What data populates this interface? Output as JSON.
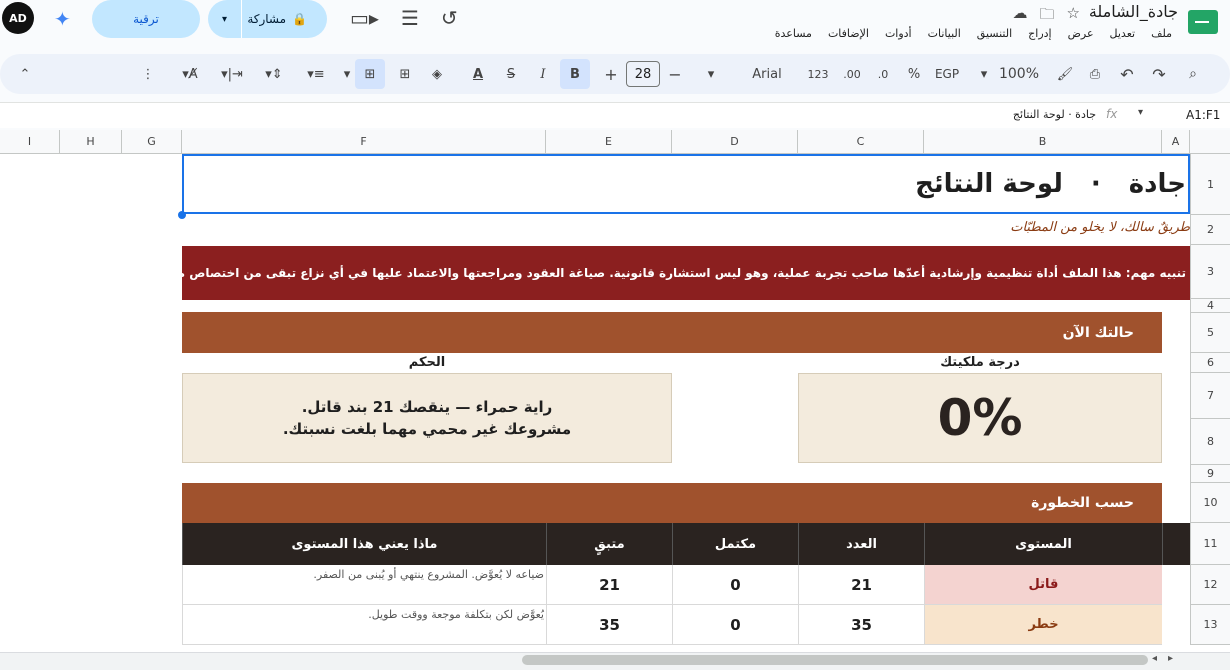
{
  "title_bar": {
    "doc_title": "جادة_الشاملة",
    "menu": [
      "ملف",
      "تعديل",
      "عرض",
      "إدراج",
      "التنسيق",
      "البيانات",
      "أدوات",
      "الإضافات",
      "مساعدة"
    ],
    "share_label": "مشاركة",
    "upgrade_label": "ترقية",
    "avatar_text": "AD"
  },
  "toolbar": {
    "zoom": "100%",
    "currency": "EGP",
    "percent": "%",
    "decimal_dec": ".0",
    "decimal_inc": ".00",
    "number_format": "123",
    "font": "Arial",
    "font_size": "28",
    "bold": "B",
    "italic": "I",
    "underline_letter": "A"
  },
  "formula_bar": {
    "cell_ref": "A1:F1",
    "fx": "fx",
    "content": "جادة · لوحة النتائج"
  },
  "columns": [
    "A",
    "B",
    "C",
    "D",
    "E",
    "F",
    "G",
    "H",
    "I"
  ],
  "rows": [
    "1",
    "2",
    "3",
    "4",
    "5",
    "6",
    "7",
    "8",
    "9",
    "10",
    "11",
    "12",
    "13"
  ],
  "sheet": {
    "title_left": "جادة",
    "title_dot": "·",
    "title_right": "لوحة النتائج",
    "tagline": "طريقٌ سالك، لا يخلو من المطبّات",
    "warning": "تنبيه مهم:  هذا الملف أداة تنظيمية وإرشادية أعدّها صاحب تجربة عملية،  وهو ليس استشارة قانونية. صياغة العقود ومراجعتها والاعتماد عليها في أي نزاع تبقى من اختصاص محامٍ مرخّص.",
    "status_header": "حالتك الآن",
    "ownership_label": "درجة ملكيتك",
    "ownership_value": "0%",
    "verdict_label": "الحكم",
    "verdict_line1": "راية حمراء — ينقصك 21 بند قاتل.",
    "verdict_line2": "مشروعك غير محمي مهما بلغت نسبتك.",
    "risk_header": "حسب الخطورة",
    "table_headers": [
      "المستوى",
      "العدد",
      "مكتمل",
      "متبقٍ",
      "ماذا يعني هذا المستوى"
    ],
    "table_rows": [
      {
        "level": "قاتل",
        "count": "21",
        "done": "0",
        "remaining": "21",
        "meaning": "ضياعه لا يُعوَّض. المشروع ينتهي أو يُبنى من الصفر.",
        "bg": "#f4d3d0",
        "color": "#8b1a1a"
      },
      {
        "level": "خطر",
        "count": "35",
        "done": "0",
        "remaining": "35",
        "meaning": "يُعوَّض لكن بتكلفة موجعة ووقت طويل.",
        "bg": "#f8e4cc",
        "color": "#8a3b12"
      }
    ]
  },
  "colors": {
    "accent": "#a0522d",
    "warning_bg": "#8b1f1f",
    "dark_header": "#2a2320",
    "card_bg": "#f3ebdd"
  }
}
